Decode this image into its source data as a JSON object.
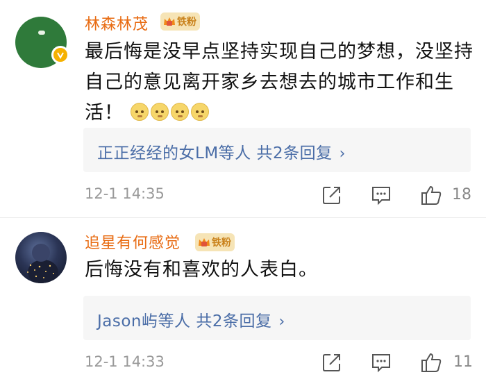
{
  "comments": [
    {
      "username": "林森林茂",
      "fan_badge": "铁粉",
      "verified": true,
      "text": "最后悔是没早点坚持实现自己的梦想，没坚持自己的意见离开家乡去想去的城市工作和生活！",
      "emoji_count": 4,
      "reply_summary": "正正经经的女LM等人  共2条回复",
      "time": "12-1 14:35",
      "likes": "18"
    },
    {
      "username": "追星有何感觉",
      "fan_badge": "铁粉",
      "verified": false,
      "text": "后悔没有和喜欢的人表白。",
      "reply_summary": "Jason屿等人  共2条回复",
      "time": "12-1 14:33",
      "likes": "11"
    }
  ],
  "colors": {
    "username": "#e86b12",
    "reply_link": "#4a6da7",
    "meta": "#999999",
    "reply_bg": "#f6f6f6",
    "fan_badge_bg": "#f6e4b6"
  }
}
